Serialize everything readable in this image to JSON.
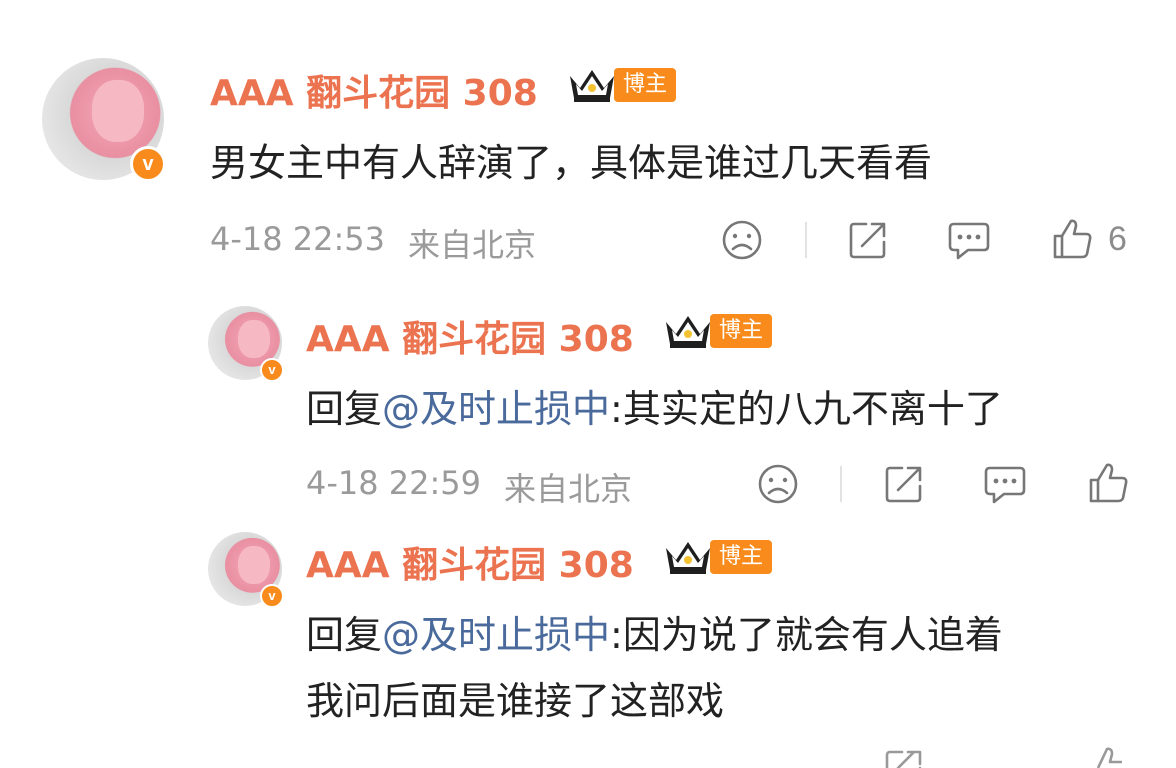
{
  "comments": [
    {
      "username": "AAA 翻斗花园 308",
      "badge": "博主",
      "verified_mark": "v",
      "reply_prefix": "",
      "mention": "",
      "text_line1": "男女主中有人辞演了，具体是谁过几天看看",
      "text_line2": "",
      "time": "4-18 22:53",
      "location": "来自北京",
      "likes": "6"
    },
    {
      "username": "AAA 翻斗花园 308",
      "badge": "博主",
      "verified_mark": "v",
      "reply_prefix": "回复",
      "mention": "@及时止损中",
      "text_line1": ":其实定的八九不离十了",
      "text_line2": "",
      "time": "4-18 22:59",
      "location": "来自北京",
      "likes": ""
    },
    {
      "username": "AAA 翻斗花园 308",
      "badge": "博主",
      "verified_mark": "v",
      "reply_prefix": "回复",
      "mention": "@及时止损中",
      "text_line1": ":因为说了就会有人追着",
      "text_line2": "我问后面是谁接了这部戏",
      "time": "",
      "location": "",
      "likes": ""
    }
  ],
  "icons": {
    "dislike": "sad-face-icon",
    "share": "share-icon",
    "comment": "comment-icon",
    "like": "thumbs-up-icon"
  },
  "colors": {
    "username": "#eb7350",
    "badge": "#f88b1b",
    "mention": "#4a6a9c",
    "meta": "#9a9a9a"
  }
}
